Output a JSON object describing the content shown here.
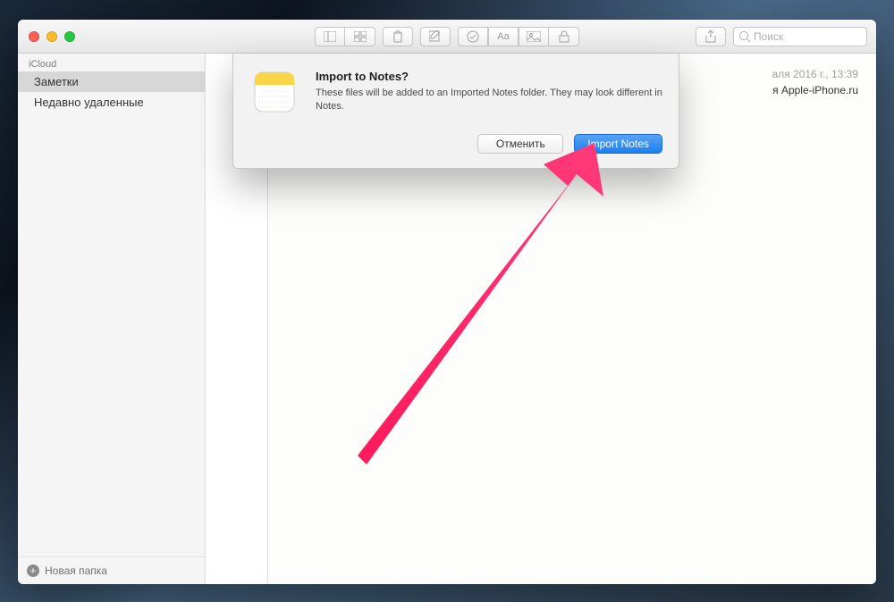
{
  "sidebar": {
    "header": "iCloud",
    "items": [
      {
        "label": "Заметки",
        "selected": true
      },
      {
        "label": "Недавно удаленные",
        "selected": false
      }
    ],
    "new_folder": "Новая папка"
  },
  "search": {
    "placeholder": "Поиск"
  },
  "note": {
    "date": "аля 2016 г., 13:39",
    "source": "я Apple-iPhone.ru"
  },
  "dialog": {
    "title": "Import to Notes?",
    "message": "These files will be added to an Imported Notes folder. They may look different in Notes.",
    "cancel": "Отменить",
    "import": "Import Notes"
  }
}
